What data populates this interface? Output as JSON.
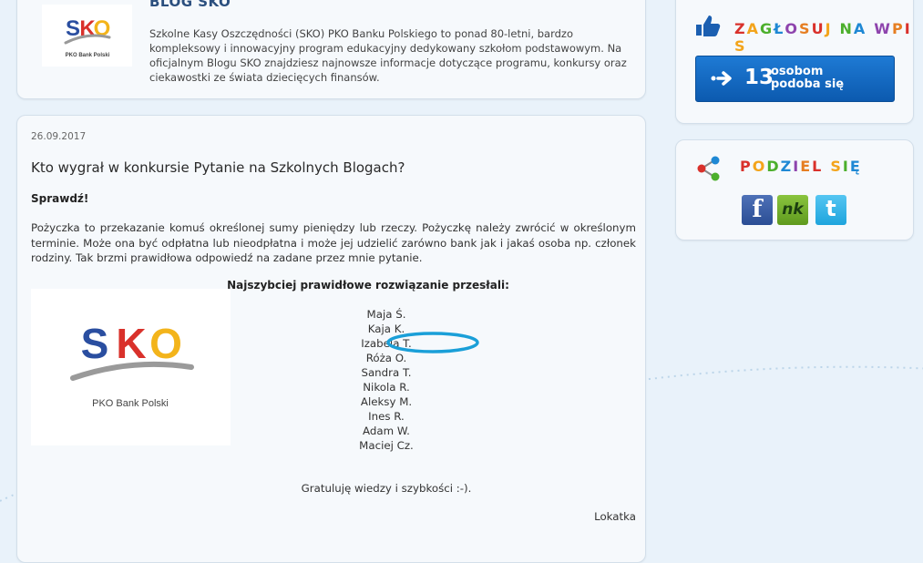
{
  "header": {
    "blog_title": "BLOG SKO",
    "description": "Szkolne Kasy Oszczędności (SKO) PKO Banku Polskiego to ponad 80-letni, bardzo kompleksowy i innowacyjny program edukacyjny dedykowany szkołom podstawowym. Na oficjalnym Blogu SKO znajdziesz najnowsze informacje dotyczące programu, konkursy oraz ciekawostki ze świata dziecięcych finansów.",
    "logo": {
      "text": "SKO",
      "sub": "PKO Bank Polski"
    }
  },
  "post": {
    "date": "26.09.2017",
    "title": "Kto wygrał w konkursie Pytanie na Szkolnych Blogach?",
    "lead": "Sprawdź!",
    "body": "Pożyczka to przekazanie komuś określonej sumy pieniędzy lub rzeczy. Pożyczkę należy zwrócić w określonym terminie. Może ona być odpłatna lub nieodpłatna i może jej udzielić zarówno bank jak i jakaś osoba np. członek rodziny. Tak brzmi prawidłowa odpowiedź na zadane przez mnie pytanie.",
    "answers_heading": "Najszybciej prawidłowe rozwiązanie przesłali:",
    "logo": {
      "text": "SKO",
      "sub": "PKO Bank Polski"
    },
    "winners": [
      "Maja Ś.",
      "Kaja K.",
      "Izabela T.",
      "Róża O.",
      "Sandra T.",
      "Nikola R.",
      "Aleksy M.",
      "Ines R.",
      "Adam W.",
      "Maciej Cz."
    ],
    "highlighted_winner": "Izabela T.",
    "highlight_color": "#1a9fd8",
    "congrats": "Gratuluję wiedzy i szybkości :-).",
    "author": "Lokatka"
  },
  "vote": {
    "title": "ZAGŁOSUJ NA WPIS",
    "like_count": "13",
    "like_label_line1": "osobom",
    "like_label_line2": "podoba się",
    "icon": "thumbs-up-icon"
  },
  "share": {
    "title": "PODZIEL SIĘ",
    "icon": "share-icon",
    "networks": [
      {
        "name": "facebook",
        "glyph": "f",
        "color": "#3b5998"
      },
      {
        "name": "nk",
        "glyph": "nk",
        "color": "#7ab534"
      },
      {
        "name": "twitter",
        "glyph": "t",
        "color": "#33b4e6"
      }
    ]
  },
  "colors": {
    "background": "#e9f2fa",
    "title_blue": "#2b4f7e",
    "button_blue": "#1466c2"
  }
}
